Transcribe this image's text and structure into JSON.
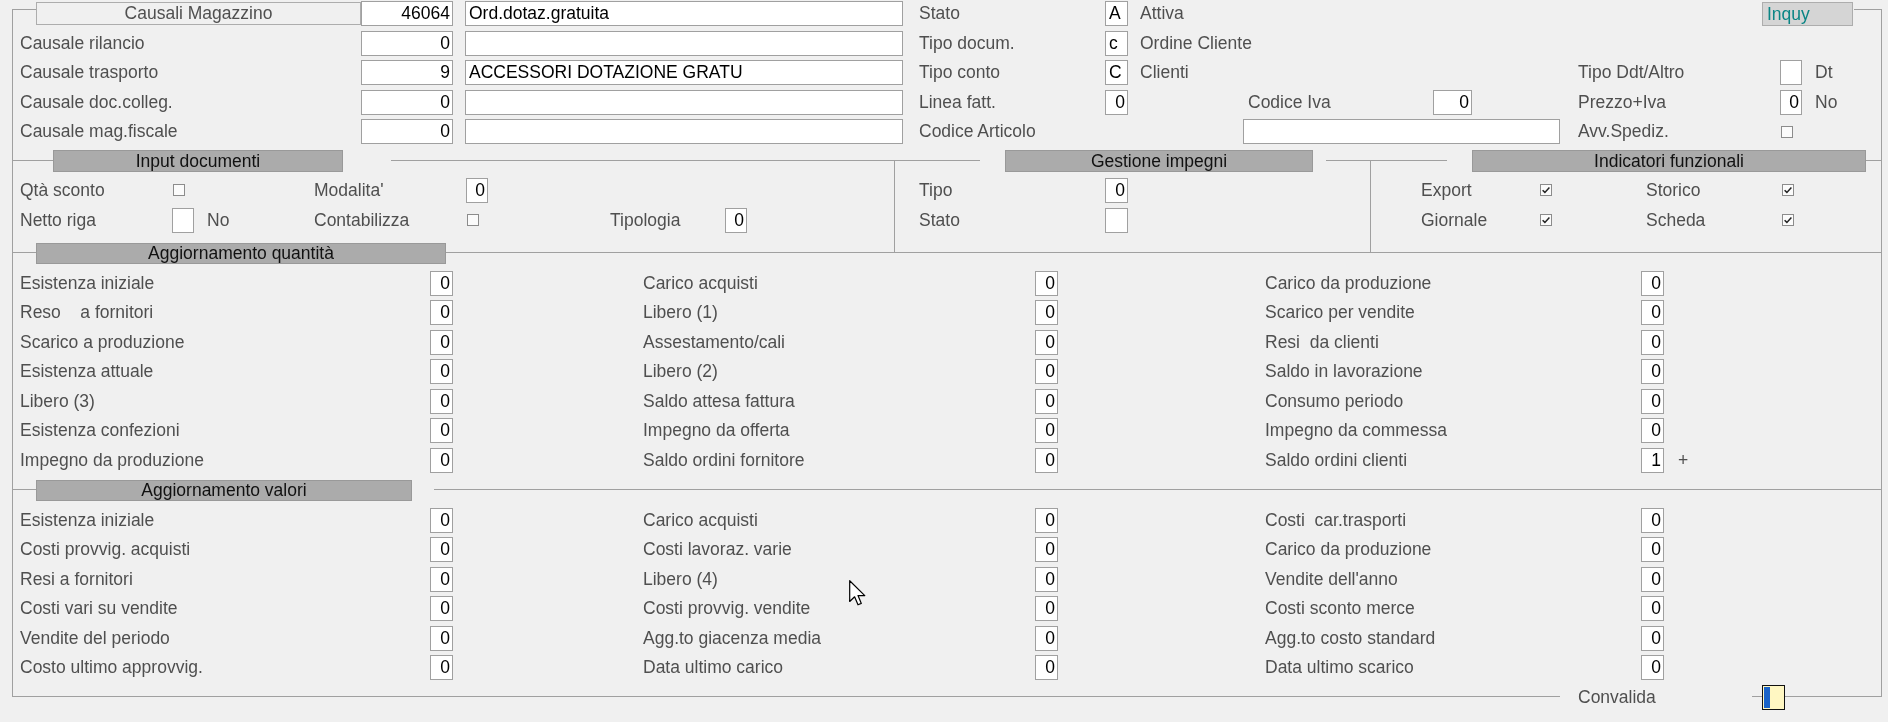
{
  "causali": {
    "title": "Causali Magazzino",
    "code": "46064",
    "description": "Ord.dotaz.gratuita"
  },
  "causali_rows": [
    {
      "label": "Causale rilancio",
      "code": "0"
    },
    {
      "label": "Causale trasporto",
      "code": "9",
      "description": "ACCESSORI DOTAZIONE GRATU"
    },
    {
      "label": "Causale doc.colleg.",
      "code": "0"
    },
    {
      "label": "Causale mag.fiscale",
      "code": "0"
    }
  ],
  "mode": "Inquy",
  "stato": {
    "label": "Stato",
    "code": "A",
    "description": "Attiva"
  },
  "tipo_docum": {
    "label": "Tipo docum.",
    "code": "c",
    "description": "Ordine Cliente"
  },
  "tipo_conto": {
    "label": "Tipo conto",
    "code": "C",
    "description": "Clienti"
  },
  "linea_fatt": {
    "label": "Linea fatt.",
    "value": "0"
  },
  "codice_iva": {
    "label": "Codice Iva",
    "value": "0"
  },
  "codice_articolo": {
    "label": "Codice Articolo"
  },
  "tipo_ddt": {
    "label": "Tipo Ddt/Altro",
    "suffix": "Dt"
  },
  "prezzo_iva": {
    "label": "Prezzo+Iva",
    "value": "0",
    "suffix": "No"
  },
  "avv_spediz": {
    "label": "Avv.Spediz.",
    "checked": false
  },
  "input_documenti": {
    "title": "Input documenti",
    "qta_sconto": {
      "label": "Qtà sconto",
      "checked": false
    },
    "modalita": {
      "label": "Modalita'",
      "value": "0"
    },
    "netto_riga": {
      "label": "Netto riga",
      "suffix": "No"
    },
    "contabilizza": {
      "label": "Contabilizza",
      "checked": false
    },
    "tipologia": {
      "label": "Tipologia",
      "value": "0"
    }
  },
  "gestione_impegni": {
    "title": "Gestione impegni",
    "fields": [
      {
        "label": "Tipo",
        "value": "0"
      },
      {
        "label": "Stato"
      }
    ]
  },
  "indicatori_funzionali": {
    "title": "Indicatori funzionali",
    "items": [
      {
        "label": "Export",
        "checked": true
      },
      {
        "label": "Storico",
        "checked": true
      },
      {
        "label": "Giornale",
        "checked": true
      },
      {
        "label": "Scheda",
        "checked": true
      }
    ]
  },
  "aggiornamento_quantita": {
    "title": "Aggiornamento quantità",
    "columns": [
      [
        {
          "label": "Esistenza iniziale",
          "value": "0"
        },
        {
          "label": "Reso    a fornitori",
          "value": "0"
        },
        {
          "label": "Scarico a produzione",
          "value": "0"
        },
        {
          "label": "Esistenza attuale",
          "value": "0"
        },
        {
          "label": "Libero (3)",
          "value": "0"
        },
        {
          "label": "Esistenza confezioni",
          "value": "0"
        },
        {
          "label": "Impegno da produzione",
          "value": "0"
        }
      ],
      [
        {
          "label": "Carico acquisti",
          "value": "0"
        },
        {
          "label": "Libero (1)",
          "value": "0"
        },
        {
          "label": "Assestamento/cali",
          "value": "0"
        },
        {
          "label": "Libero (2)",
          "value": "0"
        },
        {
          "label": "Saldo attesa fattura",
          "value": "0"
        },
        {
          "label": "Impegno da offerta",
          "value": "0"
        },
        {
          "label": "Saldo ordini fornitore",
          "value": "0"
        }
      ],
      [
        {
          "label": "Carico da produzione",
          "value": "0"
        },
        {
          "label": "Scarico per vendite",
          "value": "0"
        },
        {
          "label": "Resi  da clienti",
          "value": "0"
        },
        {
          "label": "Saldo in lavorazione",
          "value": "0"
        },
        {
          "label": "Consumo periodo",
          "value": "0"
        },
        {
          "label": "Impegno da commessa",
          "value": "0"
        },
        {
          "label": "Saldo ordini clienti",
          "value": "1",
          "suffix": "+"
        }
      ]
    ]
  },
  "aggiornamento_valori": {
    "title": "Aggiornamento valori",
    "columns": [
      [
        {
          "label": "Esistenza iniziale",
          "value": "0"
        },
        {
          "label": "Costi provvig. acquisti",
          "value": "0"
        },
        {
          "label": "Resi a fornitori",
          "value": "0"
        },
        {
          "label": "Costi vari su vendite",
          "value": "0"
        },
        {
          "label": "Vendite del periodo",
          "value": "0"
        },
        {
          "label": "Costo ultimo approvvig.",
          "value": "0"
        }
      ],
      [
        {
          "label": "Carico acquisti",
          "value": "0"
        },
        {
          "label": "Costi lavoraz. varie",
          "value": "0"
        },
        {
          "label": "Libero (4)",
          "value": "0"
        },
        {
          "label": "Costi provvig. vendite",
          "value": "0"
        },
        {
          "label": "Agg.to giacenza media",
          "value": "0"
        },
        {
          "label": "Data ultimo carico",
          "value": "0"
        }
      ],
      [
        {
          "label": "Costi  car.trasporti",
          "value": "0"
        },
        {
          "label": "Carico da produzione",
          "value": "0"
        },
        {
          "label": "Vendite dell'anno",
          "value": "0"
        },
        {
          "label": "Costi sconto merce",
          "value": "0"
        },
        {
          "label": "Agg.to costo standard",
          "value": "0"
        },
        {
          "label": "Data ultimo scarico",
          "value": "0"
        }
      ]
    ]
  },
  "convalida": {
    "label": "Convalida"
  }
}
